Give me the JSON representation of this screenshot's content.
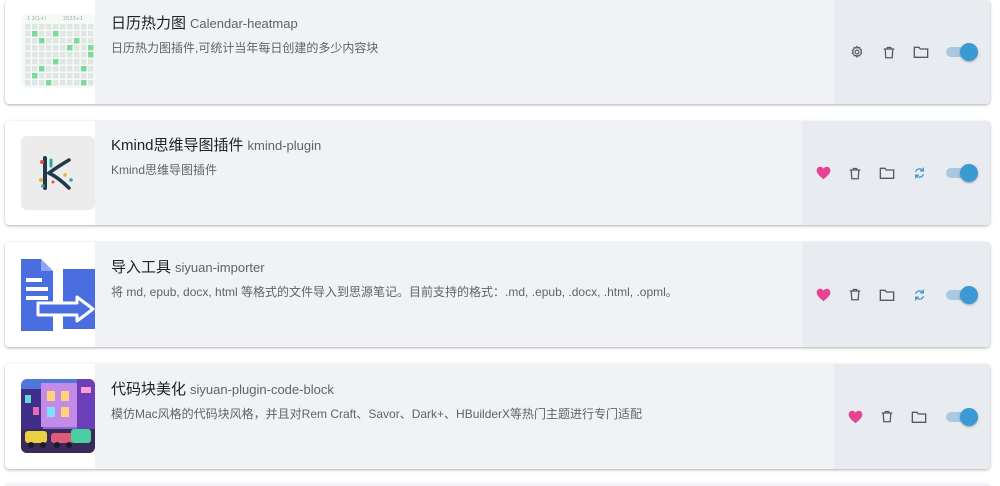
{
  "plugins": [
    {
      "title": "日历热力图",
      "name": "Calendar-heatmap",
      "description": "日历热力图插件,可统计当年每日创建的多少内容块",
      "thumb_label_left": "1 2(1+)",
      "thumb_label_right": "2023+1",
      "actions": [
        "gear-icon",
        "trash-icon",
        "folder-icon"
      ],
      "enabled": true
    },
    {
      "title": "Kmind思维导图插件",
      "name": "kmind-plugin",
      "description": "Kmind思维导图插件",
      "actions": [
        "heart-icon",
        "trash-icon",
        "folder-icon",
        "refresh-icon"
      ],
      "enabled": true
    },
    {
      "title": "导入工具",
      "name": "siyuan-importer",
      "description": "将 md, epub, docx, html 等格式的文件导入到思源笔记。目前支持的格式：.md, .epub, .docx, .html, .opml。",
      "actions": [
        "heart-icon",
        "trash-icon",
        "folder-icon",
        "refresh-icon"
      ],
      "enabled": true
    },
    {
      "title": "代码块美化",
      "name": "siyuan-plugin-code-block",
      "description": "模仿Mac风格的代码块风格，并且对Rem Craft、Savor、Dark+、HBuilderX等热门主题进行专门适配",
      "actions": [
        "heart-icon",
        "trash-icon",
        "folder-icon"
      ],
      "enabled": true
    }
  ],
  "colors": {
    "heart": "#e84393",
    "refresh": "#3b99d4",
    "icon": "#555a61",
    "toggle_on": "#3b99d4",
    "heatmap_green": "#7ed99b"
  }
}
